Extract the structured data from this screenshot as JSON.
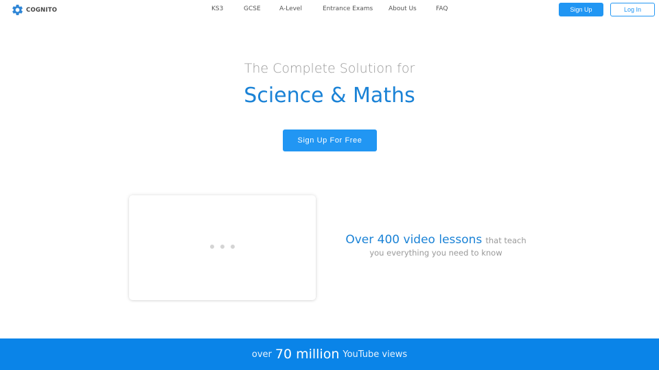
{
  "header": {
    "logo_text": "COGNITO",
    "logo_icon": "gear-icon",
    "nav_links": [
      {
        "label": "KS3"
      },
      {
        "label": "GCSE"
      },
      {
        "label": "A-Level"
      },
      {
        "label": "Entrance Exams"
      },
      {
        "label": "About Us"
      },
      {
        "label": "FAQ"
      }
    ],
    "signup_label": "Sign Up",
    "login_label": "Log In"
  },
  "hero": {
    "subtitle": "The Complete Solution for",
    "title": "Science & Maths",
    "cta_label": "Sign Up For Free"
  },
  "video_section": {
    "loader_icon": "loading-dots-icon",
    "highlight": "Over 400 video lessons",
    "rest_line1": "that teach",
    "rest_line2": "you everything you need to know"
  },
  "stats": {
    "prefix": "over",
    "value": "70 million",
    "suffix": "YouTube views"
  },
  "colors": {
    "accent": "#2196f3",
    "title_blue": "#1a82d6",
    "stats_bar": "#0a84e8",
    "muted_text": "#999999"
  }
}
